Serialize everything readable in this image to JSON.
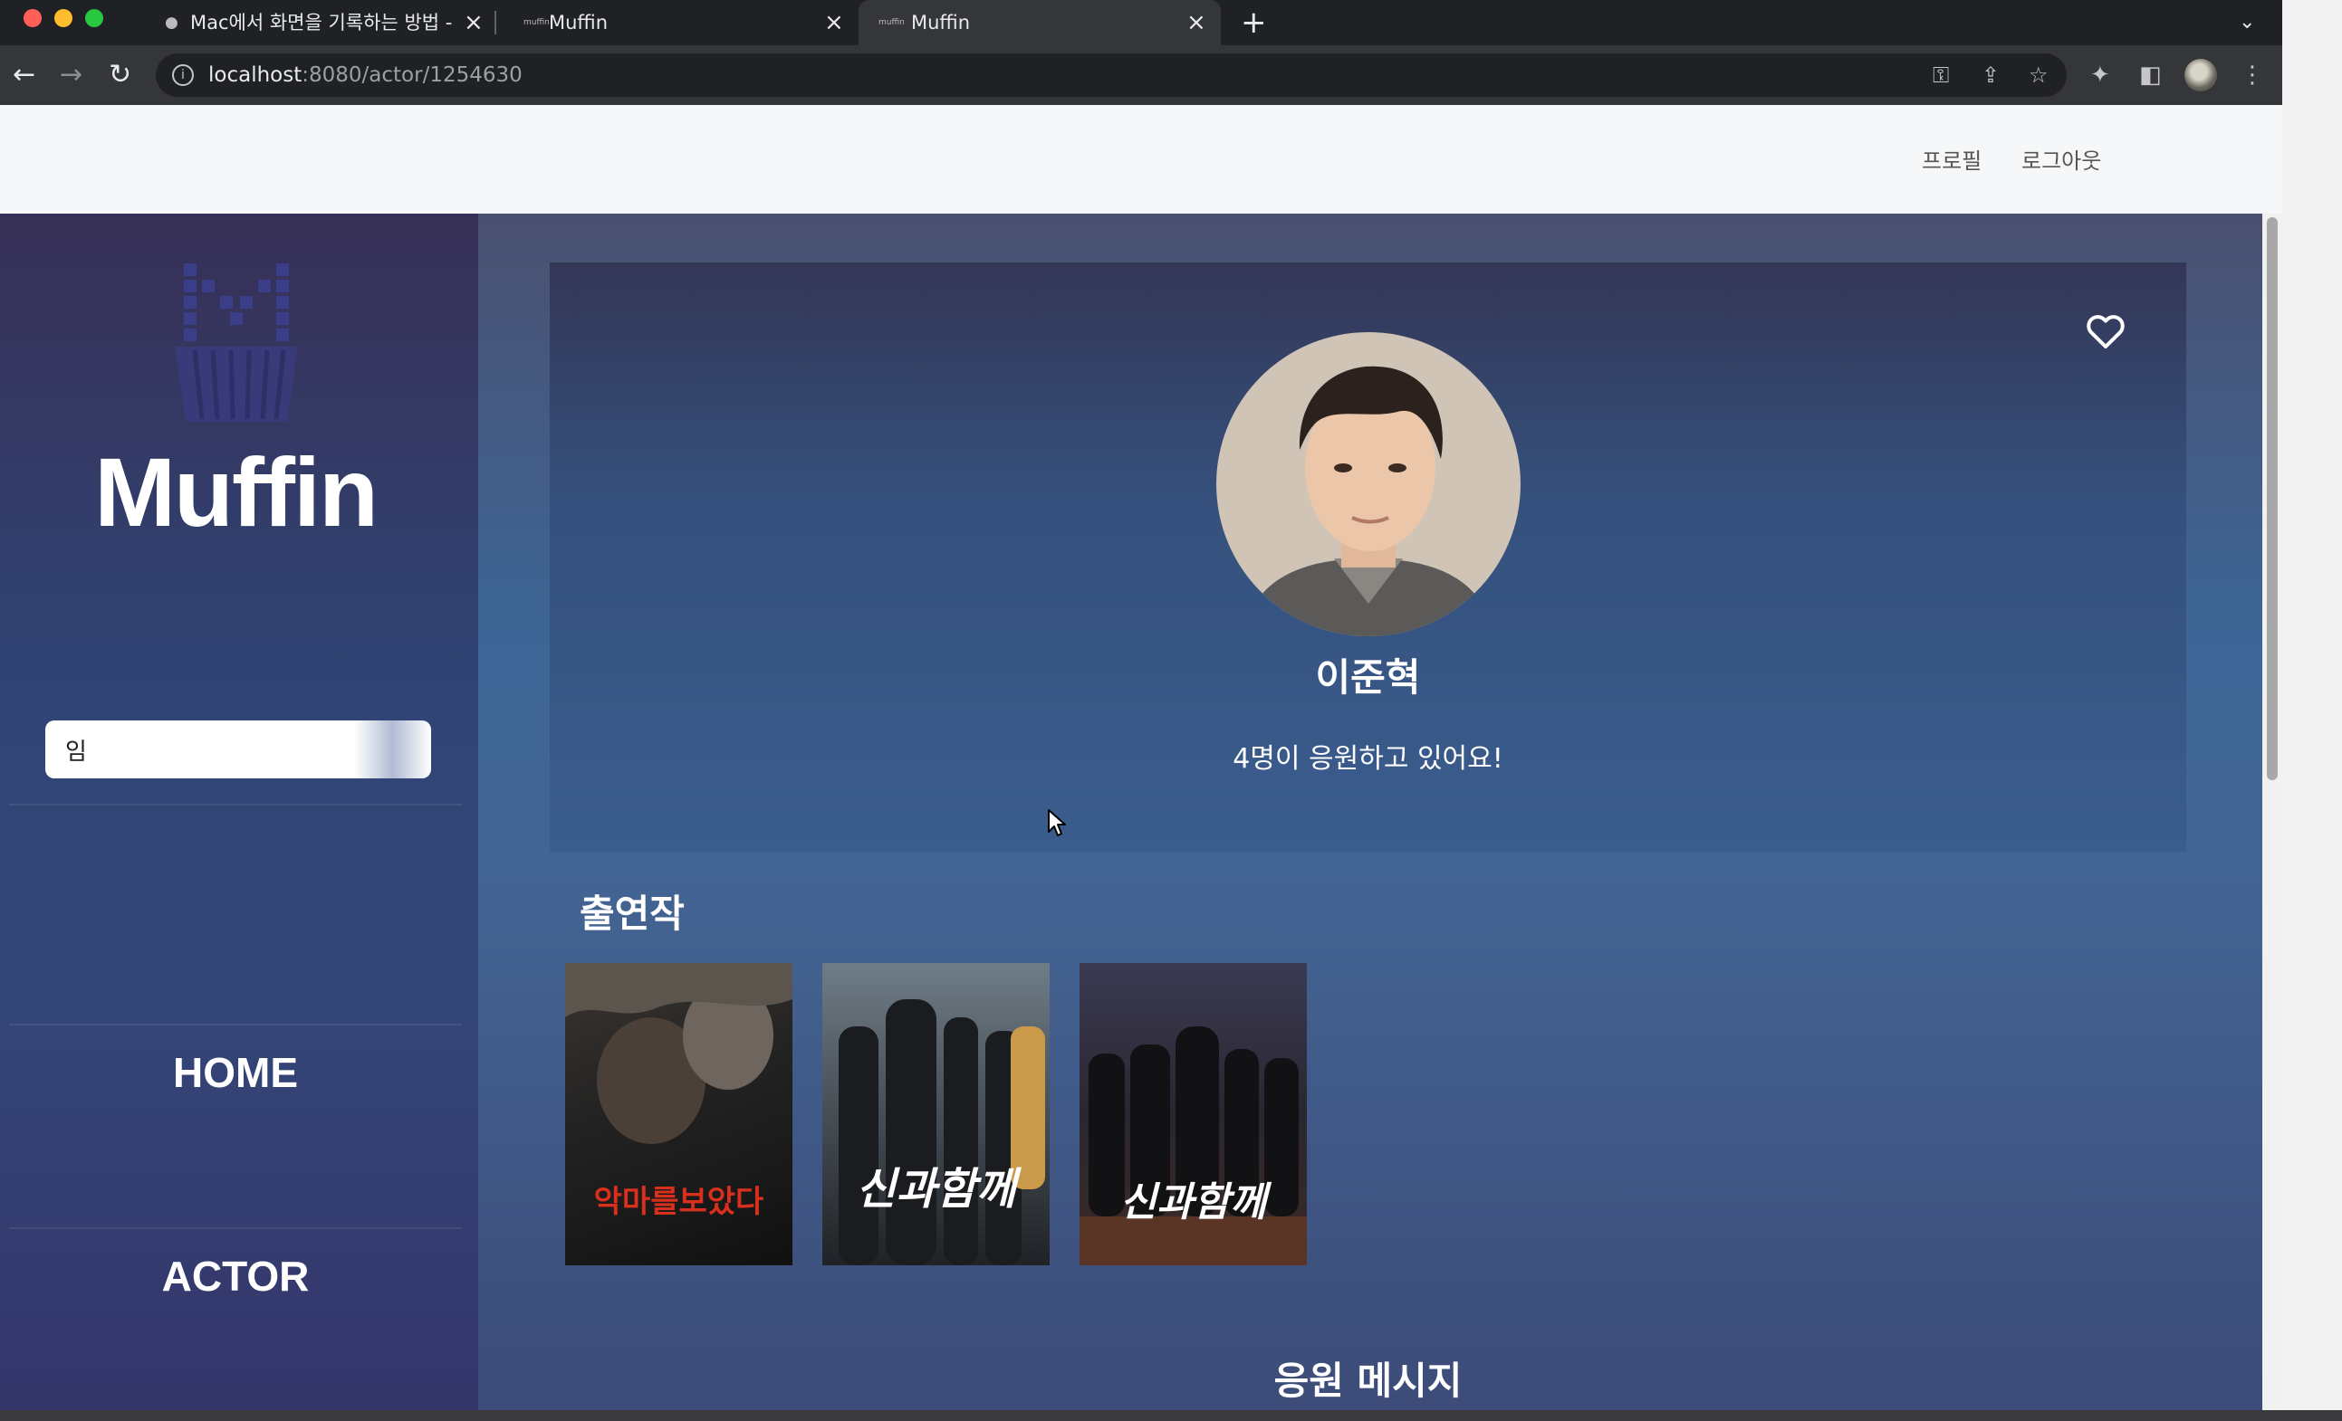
{
  "browser": {
    "tabs": [
      {
        "title": "Mac에서 화면을 기록하는 방법 - Ap",
        "favicon": "apple-icon",
        "active": false
      },
      {
        "title": "Muffin",
        "favicon": "muffin-favicon",
        "active": false
      },
      {
        "title": "Muffin",
        "favicon": "muffin-favicon",
        "active": true
      }
    ],
    "url_host": "localhost",
    "url_path": ":8080/actor/1254630",
    "toolbar_icons": [
      "back-icon",
      "forward-icon",
      "reload-icon",
      "info-icon",
      "key-icon",
      "share-icon",
      "star-icon",
      "extensions-icon",
      "sidepanel-icon",
      "profile-avatar",
      "more-icon"
    ]
  },
  "topnav": {
    "profile_label": "프로필",
    "logout_label": "로그아웃"
  },
  "sidebar": {
    "brand": "Muffin",
    "search_value": "임",
    "nav": [
      {
        "label": "HOME"
      },
      {
        "label": "ACTOR"
      }
    ]
  },
  "actor": {
    "name": "이준혁",
    "cheer_text": "4명이 응원하고 있어요!",
    "favorite_icon": "heart-outline-icon"
  },
  "filmography": {
    "title": "출연작",
    "posters": [
      {
        "title": "악마를보았다"
      },
      {
        "title": "신과함께"
      },
      {
        "title": "신과함께"
      }
    ]
  },
  "messages": {
    "title": "응원 메시지"
  },
  "colors": {
    "sidebar_top": "#372f56",
    "content_mid": "#3d6696",
    "hero_top": "#343656",
    "poster1_accent": "#d8301d"
  }
}
